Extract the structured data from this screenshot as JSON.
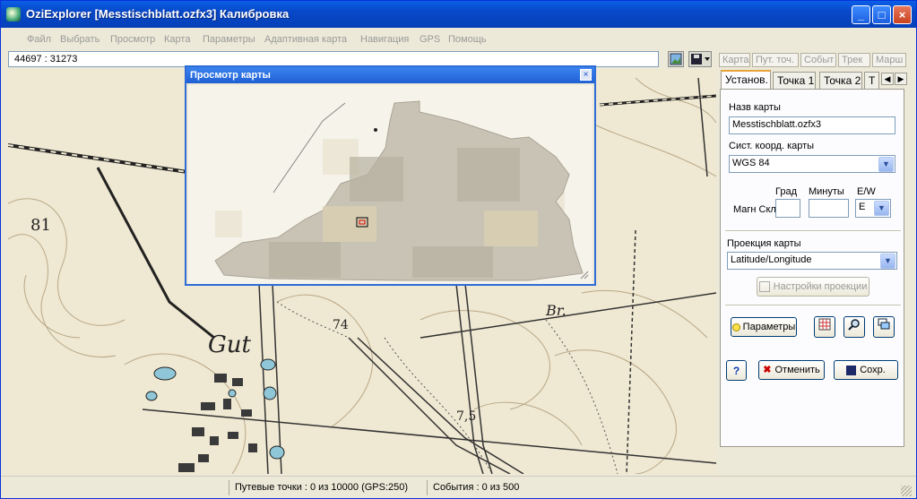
{
  "window": {
    "title": "OziExplorer [Messtischblatt.ozfx3] Калибровка"
  },
  "menu": [
    "Файл",
    "Выбрать",
    "Просмотр",
    "Карта",
    "Параметры",
    "Адаптивная карта",
    "Навигация",
    "GPS",
    "Помощь"
  ],
  "coords": "44697 : 31273",
  "toolbar_tabs": [
    "Карта",
    "Пут. точ.",
    "Событ",
    "Трек",
    "Марш"
  ],
  "overview": {
    "title": "Просмотр карты"
  },
  "map_labels": {
    "label_gut": "Gut",
    "label_br": "Br.",
    "label_74": "74",
    "label_75": "7,5",
    "label_81": "81"
  },
  "panel": {
    "tabs": [
      "Установ.",
      "Точка 1",
      "Точка 2",
      "Т"
    ],
    "map_name_label": "Назв карты",
    "map_name_value": "Messtischblatt.ozfx3",
    "coord_sys_label": "Сист. коорд. карты",
    "coord_sys_value": "WGS 84",
    "deg_label": "Град",
    "min_label": "Минуты",
    "ew_label": "E/W",
    "magn_label": "Магн Скл",
    "ew_value": "E",
    "projection_label": "Проекция карты",
    "projection_value": "Latitude/Longitude",
    "projection_settings_label": "Настройки проекции",
    "params_button_label": "Параметры",
    "cancel_button_label": "Отменить",
    "save_button_label": "Сохр."
  },
  "status": {
    "waypoints": "Путевые точки : 0 из 10000  (GPS:250)",
    "events": "События : 0 из 500"
  },
  "colors": {
    "title_bar": "#0a5fe6",
    "map_paper": "#efe8d2",
    "map_ink": "#2a2a2a",
    "water": "#8fc7d8"
  }
}
